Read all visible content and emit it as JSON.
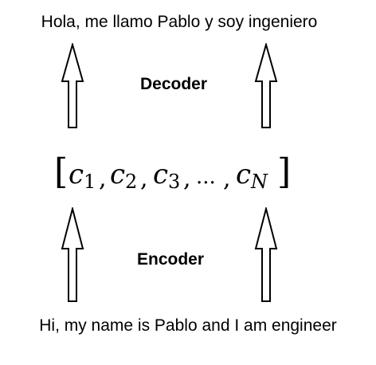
{
  "output_sentence": "Hola, me llamo Pablo y soy ingeniero",
  "input_sentence": "Hi, my name is Pablo and I am engineer",
  "decoder_label": "Decoder",
  "encoder_label": "Encoder",
  "context_vector": {
    "open_bracket": "[",
    "close_bracket": "]",
    "separator": ",",
    "ellipsis": "...",
    "components": [
      {
        "base": "c",
        "subscript": "1"
      },
      {
        "base": "c",
        "subscript": "2"
      },
      {
        "base": "c",
        "subscript": "3"
      },
      {
        "base": "c",
        "subscript": "N"
      }
    ]
  }
}
